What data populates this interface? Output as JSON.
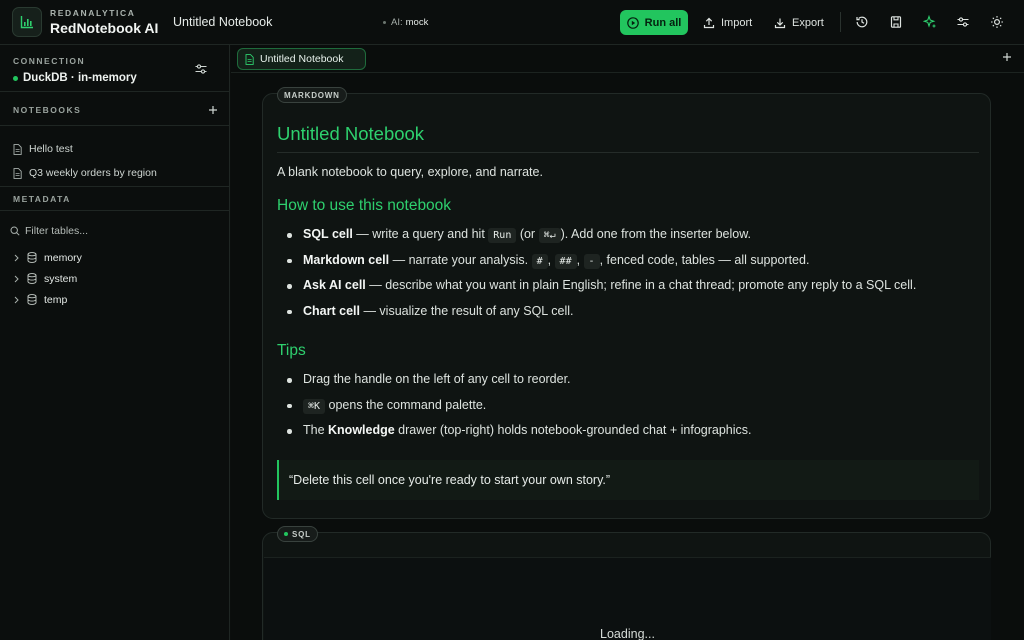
{
  "header": {
    "brand_eyebrow": "REDANALYTICA",
    "brand_name": "RedNotebook AI",
    "notebook_title": "Untitled Notebook",
    "ai_label": "AI:",
    "ai_value": "mock",
    "run_all_label": "Run all",
    "import_label": "Import",
    "export_label": "Export",
    "icons": [
      "history-icon",
      "save-icon",
      "sparkle-icon",
      "settings-sliders-icon",
      "theme-sun-icon"
    ]
  },
  "sidebar": {
    "connection_label": "CONNECTION",
    "connection_value": "DuckDB · in-memory",
    "notebooks_label": "NOTEBOOKS",
    "notebooks": [
      {
        "label": "Hello test"
      },
      {
        "label": "Q3 weekly orders by region"
      }
    ],
    "metadata_label": "METADATA",
    "filter_placeholder": "Filter tables...",
    "schemas": [
      {
        "label": "memory"
      },
      {
        "label": "system"
      },
      {
        "label": "temp"
      }
    ]
  },
  "main": {
    "tab_label": "Untitled Notebook",
    "markdown_cell": {
      "badge": "MARKDOWN",
      "title": "Untitled Notebook",
      "lead": "A blank notebook to query, explore, and narrate.",
      "h2_usage": "How to use this notebook",
      "usage": {
        "sql_bold": "SQL cell",
        "sql_a": " — write a query and hit ",
        "sql_code1": "Run",
        "sql_b": " (or ",
        "sql_code2": "⌘↵",
        "sql_c": "). Add one from the inserter below.",
        "md_bold": "Markdown cell",
        "md_a": " — narrate your analysis. ",
        "md_code1": "#",
        "md_sep1": ", ",
        "md_code2": "##",
        "md_sep2": ", ",
        "md_code3": "-",
        "md_b": ", fenced code, tables — all supported.",
        "ai_bold": "Ask AI cell",
        "ai_a": " — describe what you want in plain English; refine in a chat thread; promote any reply to a SQL cell.",
        "chart_bold": "Chart cell",
        "chart_a": " — visualize the result of any SQL cell."
      },
      "h2_tips": "Tips",
      "tips": {
        "t1": "Drag the handle on the left of any cell to reorder.",
        "t2_code": "⌘K",
        "t2_a": " opens the command palette.",
        "t3_a": "The ",
        "t3_bold": "Knowledge",
        "t3_b": " drawer (top-right) holds notebook-grounded chat + infographics."
      },
      "quote": "“Delete this cell once you're ready to start your own story.”"
    },
    "sql_cell": {
      "badge": "SQL",
      "loading": "Loading..."
    }
  },
  "colors": {
    "accent": "#22c55e",
    "background": "#0b0e0d",
    "cell_background": "#0f1412"
  }
}
